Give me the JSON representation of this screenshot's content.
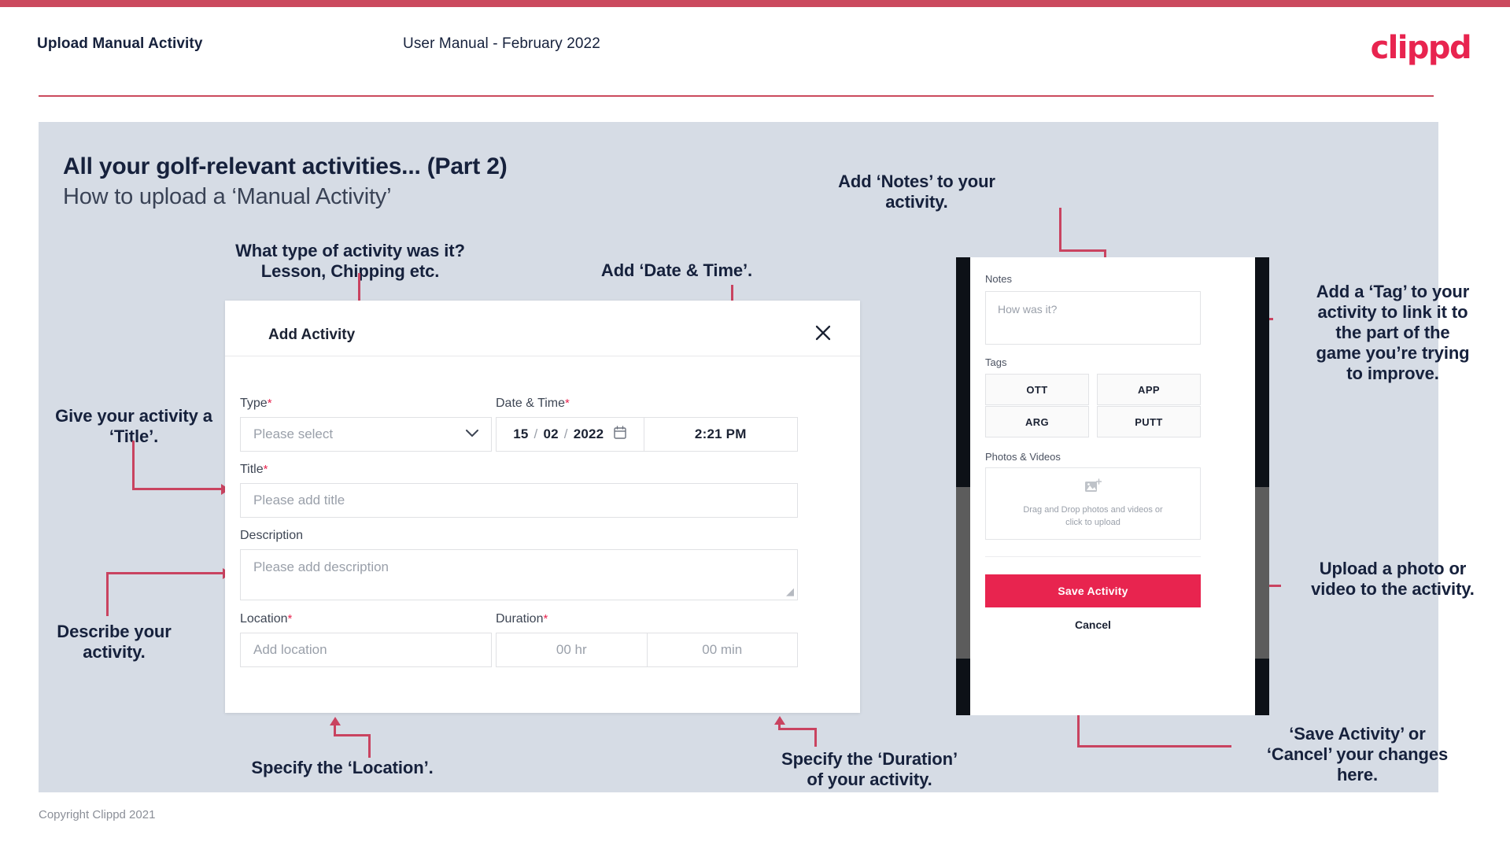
{
  "header": {
    "left_title": "Upload Manual Activity",
    "center_title": "User Manual - February 2022",
    "logo": "clippd"
  },
  "slide": {
    "title_line1": "All your golf-relevant activities... (Part 2)",
    "title_line2": "How to upload a ‘Manual Activity’",
    "footer": "Copyright Clippd 2021"
  },
  "dialog": {
    "title": "Add Activity",
    "close_icon": "close-icon",
    "fields": {
      "type": {
        "label": "Type",
        "required": "*",
        "placeholder": "Please select",
        "chevron_icon": "chevron-down-icon"
      },
      "datetime": {
        "label": "Date & Time",
        "required": "*",
        "day": "15",
        "month": "02",
        "year": "2022",
        "slash": "/",
        "calendar_icon": "calendar-icon",
        "time": "2:21 PM"
      },
      "title": {
        "label": "Title",
        "required": "*",
        "placeholder": "Please add title"
      },
      "description": {
        "label": "Description",
        "placeholder": "Please add description"
      },
      "location": {
        "label": "Location",
        "required": "*",
        "placeholder": "Add location"
      },
      "duration": {
        "label": "Duration",
        "required": "*",
        "hours": "00 hr",
        "minutes": "00 min"
      }
    }
  },
  "phone": {
    "notes": {
      "label": "Notes",
      "placeholder": "How was it?"
    },
    "tags": {
      "label": "Tags",
      "items": [
        "OTT",
        "APP",
        "ARG",
        "PUTT"
      ]
    },
    "photos": {
      "label": "Photos & Videos",
      "icon": "add-photo-icon",
      "drop_line1": "Drag and Drop photos and videos or",
      "drop_line2": "click to upload"
    },
    "save_label": "Save Activity",
    "cancel_label": "Cancel"
  },
  "annotations": {
    "type": "What type of activity was it?\nLesson, Chipping etc.",
    "datetime": "Add ‘Date & Time’.",
    "title": "Give your activity a\n‘Title’.",
    "description": "Describe your\nactivity.",
    "location": "Specify the ‘Location’.",
    "duration": "Specify the ‘Duration’\nof your activity.",
    "notes": "Add ‘Notes’ to your\nactivity.",
    "tags": "Add a ‘Tag’ to your\nactivity to link it to\nthe part of the\ngame you’re trying\nto improve.",
    "upload": "Upload a photo or\nvideo to the activity.",
    "save": "‘Save Activity’ or\n‘Cancel’ your changes\nhere."
  },
  "colors": {
    "accent": "#e8244f",
    "rule": "#cb4a5e",
    "connector": "#c94360",
    "slide_bg": "#d6dce5",
    "ink": "#16213c"
  }
}
